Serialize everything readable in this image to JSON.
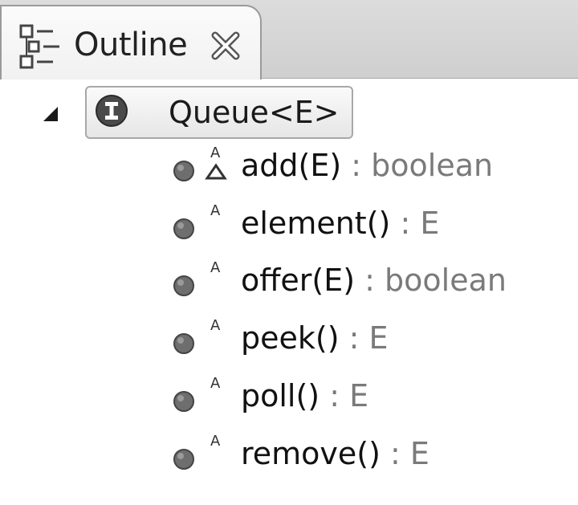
{
  "view": {
    "title": "Outline",
    "icon": "outline-view-icon",
    "close_icon": "close-x-icon"
  },
  "tree": {
    "root": {
      "label": "Queue<E>",
      "icon": "interface-icon",
      "expanded": true
    },
    "members": [
      {
        "name": "add(E)",
        "type": " : boolean",
        "icon": "public-method-icon",
        "modifier": "abstract",
        "overrides": true
      },
      {
        "name": "element()",
        "type": " : E",
        "icon": "public-method-icon",
        "modifier": "abstract",
        "overrides": false
      },
      {
        "name": "offer(E)",
        "type": " : boolean",
        "icon": "public-method-icon",
        "modifier": "abstract",
        "overrides": false
      },
      {
        "name": "peek()",
        "type": " : E",
        "icon": "public-method-icon",
        "modifier": "abstract",
        "overrides": false
      },
      {
        "name": "poll()",
        "type": " : E",
        "icon": "public-method-icon",
        "modifier": "abstract",
        "overrides": false
      },
      {
        "name": "remove()",
        "type": " : E",
        "icon": "public-method-icon",
        "modifier": "abstract",
        "overrides": false
      }
    ]
  },
  "abstract_marker": "A",
  "colors": {
    "tab_bar": "#d6d6d6",
    "selection_border": "#a8a8a8",
    "method_dot": "#6e6e6e",
    "return_type": "#7a7a7a"
  }
}
